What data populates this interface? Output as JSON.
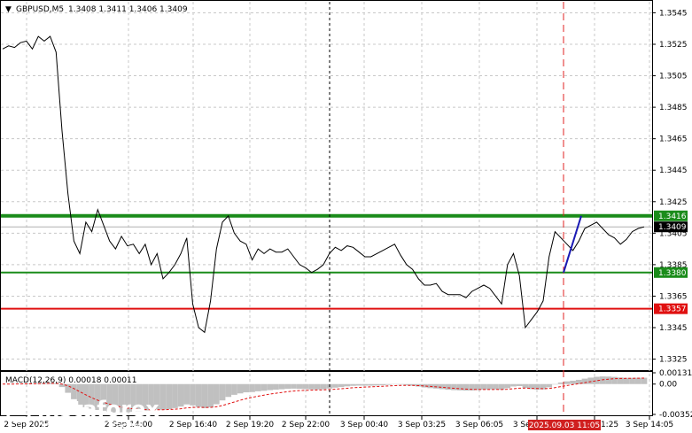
{
  "header": {
    "arrow": "▼",
    "symbol": "GBPUSD,M5",
    "ohlc": "1.3408 1.3411 1.3406 1.3409"
  },
  "macd": {
    "label": "MACD(12,26,9) 0.00018 0.00011",
    "axis_labels": [
      "0.00131",
      "0.00",
      "-0.00352"
    ]
  },
  "price_axis_labels": [
    "1.3545",
    "1.3525",
    "1.3505",
    "1.3485",
    "1.3465",
    "1.3445",
    "1.3425",
    "1.3405",
    "1.3385",
    "1.3365",
    "1.3345",
    "1.3325"
  ],
  "levels": [
    {
      "name": "upper-green-level",
      "value": 1.3416,
      "label": "1.3416",
      "color": "#1a8c1a",
      "thick": true
    },
    {
      "name": "lower-green-level",
      "value": 1.338,
      "label": "1.3380",
      "color": "#1a8c1a",
      "thick": false
    },
    {
      "name": "red-level",
      "value": 1.3357,
      "label": "1.3357",
      "color": "#e01010",
      "thick": false
    }
  ],
  "current_price": {
    "value": 1.3409,
    "label": "1.3409"
  },
  "time_labels": [
    "2 Sep 2025",
    "2 Sep 14:00",
    "2 Sep 16:40",
    "2 Sep 19:20",
    "2 Sep 22:00",
    "3 Sep 00:40",
    "3 Sep 03:25",
    "3 Sep 06:05",
    "3 Sep 08:45",
    "3 Sep 11:25",
    "3 Sep 14:05"
  ],
  "highlight_time_label": "2025.09.03 11:05",
  "watermark": {
    "brand": "instaforex",
    "tagline": "Instant Forex Trading"
  },
  "colors": {
    "price_line": "#000000",
    "signal_line": "#1a1ab4",
    "grid": "#c8c8c8",
    "macd_hist": "#c0c0c0",
    "macd_signal": "#e01010",
    "highlight_tag": "#d02020",
    "vertical_marker": "#e02020"
  },
  "chart_data": {
    "type": "line",
    "title": "GBPUSD,M5",
    "ylim": [
      1.3318,
      1.3552
    ],
    "y_ticks": [
      1.3545,
      1.3525,
      1.3505,
      1.3485,
      1.3465,
      1.3445,
      1.3425,
      1.3405,
      1.3385,
      1.3365,
      1.3345,
      1.3325
    ],
    "x_tick_labels": [
      "2 Sep 2025",
      "2 Sep 14:00",
      "2 Sep 16:40",
      "2 Sep 19:20",
      "2 Sep 22:00",
      "3 Sep 00:40",
      "3 Sep 03:25",
      "3 Sep 06:05",
      "3 Sep 08:45",
      "3 Sep 11:25",
      "3 Sep 14:05"
    ],
    "series": [
      {
        "name": "GBPUSD,M5",
        "values": [
          1.3522,
          1.3524,
          1.3523,
          1.3526,
          1.3527,
          1.3522,
          1.353,
          1.3527,
          1.353,
          1.352,
          1.347,
          1.343,
          1.34,
          1.3392,
          1.3412,
          1.3406,
          1.342,
          1.341,
          1.34,
          1.3395,
          1.3403,
          1.3397,
          1.3398,
          1.3392,
          1.3398,
          1.3385,
          1.3392,
          1.3376,
          1.338,
          1.3385,
          1.3392,
          1.3402,
          1.336,
          1.3345,
          1.3342,
          1.3362,
          1.3395,
          1.3412,
          1.3416,
          1.3405,
          1.34,
          1.3398,
          1.3388,
          1.3395,
          1.3392,
          1.3395,
          1.3393,
          1.3393,
          1.3395,
          1.339,
          1.3385,
          1.3383,
          1.338,
          1.3382,
          1.3385,
          1.3392,
          1.3396,
          1.3394,
          1.3397,
          1.3396,
          1.3393,
          1.339,
          1.339,
          1.3392,
          1.3394,
          1.3396,
          1.3398,
          1.3391,
          1.3385,
          1.3382,
          1.3376,
          1.3372,
          1.3372,
          1.3373,
          1.3368,
          1.3366,
          1.3366,
          1.3366,
          1.3364,
          1.3368,
          1.337,
          1.3372,
          1.337,
          1.3365,
          1.336,
          1.3385,
          1.3392,
          1.3378,
          1.3345,
          1.335,
          1.3355,
          1.3362,
          1.339,
          1.3406,
          1.3402,
          1.3398,
          1.3394,
          1.34,
          1.3408,
          1.341,
          1.3412,
          1.3408,
          1.3404,
          1.3402,
          1.3398,
          1.3401,
          1.3406,
          1.3408,
          1.3409
        ]
      },
      {
        "name": "signal-segment",
        "from": 1.338,
        "to": 1.3416
      }
    ],
    "macd_series": {
      "name": "MACD(12,26,9)",
      "macd": 0.00018,
      "signal": 0.00011,
      "ylim": [
        -0.00352,
        0.00131
      ]
    },
    "grid": true
  }
}
